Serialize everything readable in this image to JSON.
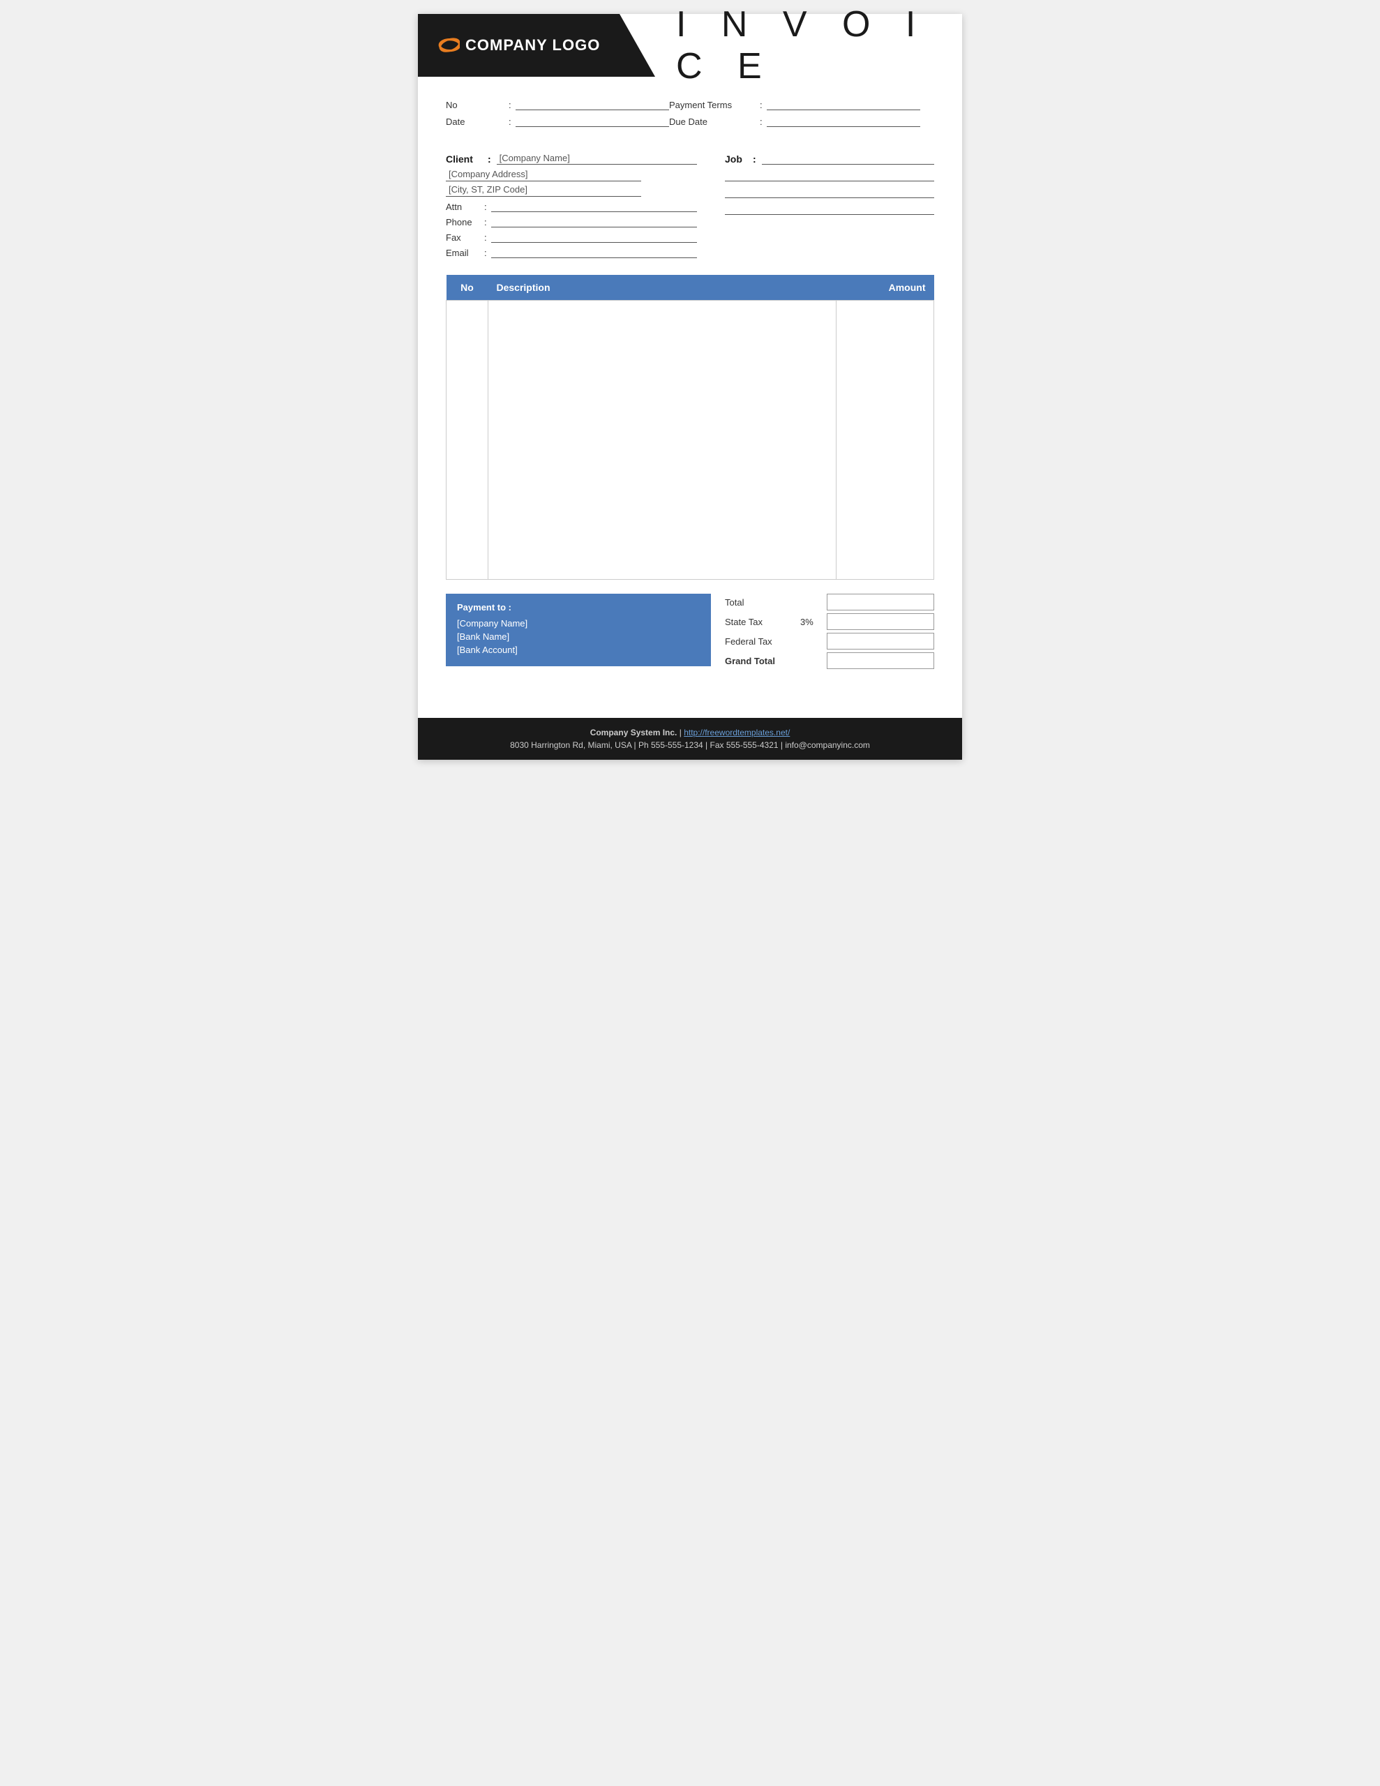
{
  "header": {
    "logo_text": "COMPANY LOGO",
    "invoice_title": "I N V O I C E"
  },
  "meta": {
    "no_label": "No",
    "no_colon": ":",
    "date_label": "Date",
    "date_colon": ":",
    "payment_terms_label": "Payment  Terms",
    "payment_terms_colon": ":",
    "due_date_label": "Due Date",
    "due_date_colon": ":"
  },
  "client": {
    "label": "Client",
    "colon": ":",
    "name": "[Company Name]",
    "address": "[Company Address]",
    "city": "[City, ST, ZIP Code]",
    "attn_label": "Attn",
    "attn_colon": ":",
    "phone_label": "Phone",
    "phone_colon": ":",
    "fax_label": "Fax",
    "fax_colon": ":",
    "email_label": "Email",
    "email_colon": ":"
  },
  "job": {
    "label": "Job",
    "colon": ":"
  },
  "table": {
    "col_no": "No",
    "col_description": "Description",
    "col_amount": "Amount"
  },
  "payment": {
    "title": "Payment to :",
    "company": "[Company Name]",
    "bank": "[Bank Name]",
    "account": "[Bank Account]"
  },
  "totals": {
    "total_label": "Total",
    "state_tax_label": "State Tax",
    "state_tax_pct": "3%",
    "federal_tax_label": "Federal Tax",
    "grand_total_label": "Grand Total"
  },
  "footer": {
    "line1_bold": "Company System Inc.",
    "line1_sep": " | ",
    "line1_link": "http://freewordtemplates.net/",
    "line2": "8030 Harrington Rd, Miami, USA | Ph 555-555-1234 | Fax 555-555-4321 | info@companyinc.com"
  }
}
